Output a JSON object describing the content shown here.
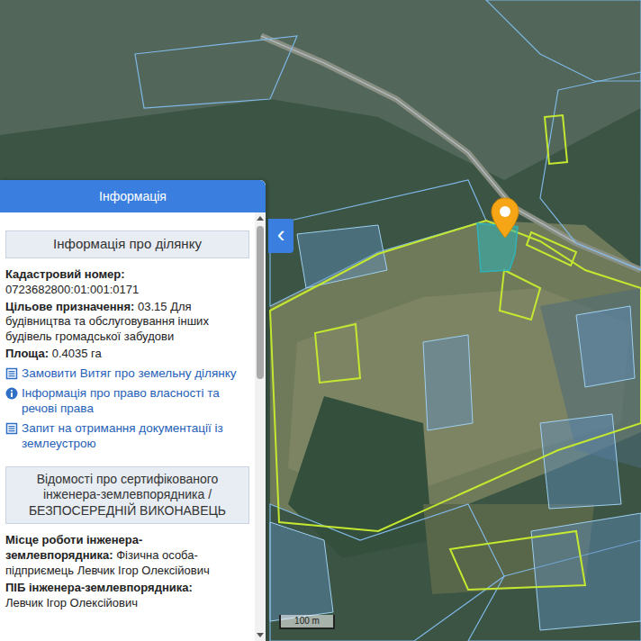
{
  "panel": {
    "title": "Інформація",
    "collapse_button": "‹",
    "parcel_section": {
      "title": "Інформація про ділянку",
      "fields": [
        {
          "label": "Кадастровий номер:",
          "value": "0723682800:01:001:0171",
          "kind": "block"
        },
        {
          "label": "Цільове призначення:",
          "value": "03.15 Для будівництва та обслуговування інших будівель громадської забудови",
          "kind": "inline"
        },
        {
          "label": "Площа:",
          "value": "0.4035 га",
          "kind": "inline"
        }
      ],
      "links": [
        {
          "text": "Замовити Витяг про земельну ділянку",
          "kind": "document"
        },
        {
          "text": "Інформація про право власності та речові права",
          "kind": "info"
        },
        {
          "text": "Запит на отримання документації із землеустрою",
          "kind": "document"
        }
      ]
    },
    "engineer_section": {
      "title": "Відомості про сертифікованого інженера-землевпорядника / БЕЗПОСЕРЕДНІЙ ВИКОНАВЕЦЬ",
      "fields": [
        {
          "label": "Місце роботи інженера-землевпорядника:",
          "value": "Фізична особа-підприємець Левчик Ігор Олексійович",
          "kind": "inline"
        },
        {
          "label": "ПІБ інженера-землевпорядника:",
          "value": "Левчик Ігор Олексійович",
          "kind": "block"
        }
      ]
    }
  },
  "map": {
    "scale": "100 m"
  }
}
